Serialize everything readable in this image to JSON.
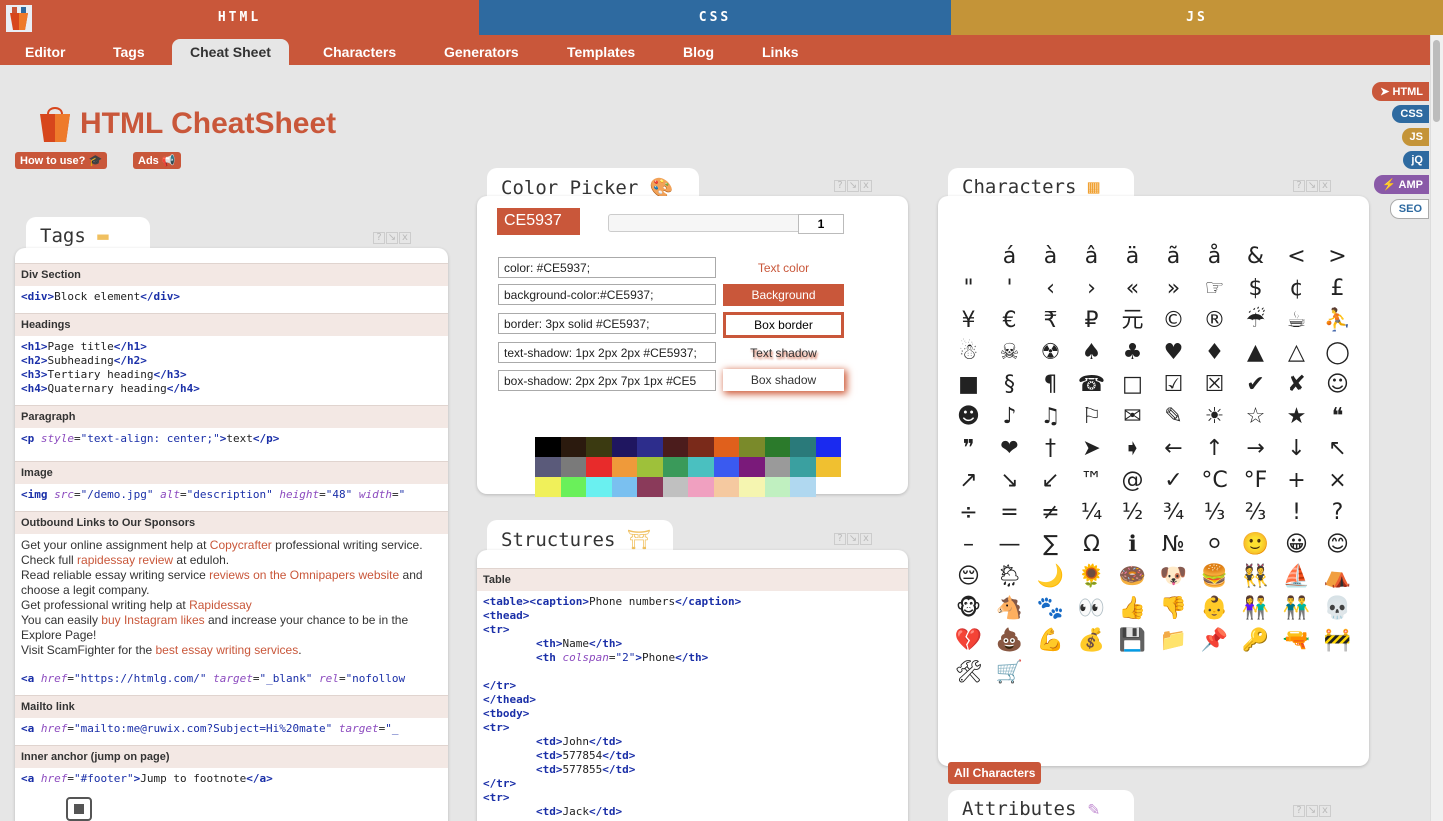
{
  "topbar": {
    "html": "HTML",
    "css": "CSS",
    "js": "JS"
  },
  "nav": [
    "Editor",
    "Tags",
    "Cheat Sheet",
    "Characters",
    "Generators",
    "Templates",
    "Blog",
    "Links"
  ],
  "side_tabs": [
    "HTML",
    "CSS",
    "JS",
    "jQ",
    "AMP",
    "SEO"
  ],
  "page_title": "HTML CheatSheet",
  "how_to_use": "How to use? 🎓",
  "ads": "Ads 📢",
  "tags_panel": {
    "title": "Tags",
    "sections": [
      {
        "header": "Div Section",
        "lines": [
          "<div>Block element</div>"
        ]
      },
      {
        "header": "Headings",
        "lines": [
          "<h1>Page title</h1>",
          "<h2>Subheading</h2>",
          "<h3>Tertiary heading</h3>",
          "<h4>Quaternary heading</h4>"
        ]
      },
      {
        "header": "Paragraph",
        "lines": [
          "<p style=\"text-align: center;\">text</p>"
        ]
      },
      {
        "header": "Image",
        "lines": [
          "<img src=\"/demo.jpg\" alt=\"description\" height=\"48\" width=\""
        ]
      }
    ],
    "sponsors_header": "Outbound Links to Our Sponsors",
    "sponsor_lines": [
      {
        "pre": "Get your online assignment help at ",
        "link": "Copycrafter",
        "post": " professional writing service."
      },
      {
        "pre": "Check full ",
        "link": "rapidessay review",
        "post": " at eduloh."
      },
      {
        "pre": "Read reliable essay writing service ",
        "link": "reviews on the Omnipapers website",
        "post": " and choose a legit company."
      },
      {
        "pre": "Get professional writing help at ",
        "link": "Rapidessay",
        "post": ""
      },
      {
        "pre": "You can easily ",
        "link": "buy Instagram likes",
        "post": " and increase your chance to be in the Explore Page!"
      },
      {
        "pre": "Visit ScamFighter for the ",
        "link": "best essay writing services",
        "post": "."
      }
    ],
    "sponsor_code": "<a href=\"https://htmlg.com/\" target=\"_blank\" rel=\"nofollow",
    "mailto_header": "Mailto link",
    "mailto_code": "<a href=\"mailto:me@ruwix.com?Subject=Hi%20mate\" target=\"_",
    "anchor_header": "Inner anchor (jump on page)",
    "anchor_code": "<a href=\"#footer\">Jump to footnote</a>"
  },
  "color_picker": {
    "title": "Color Picker 🎨",
    "hex": "CE5937",
    "slider_value": "1",
    "rows": [
      {
        "code": "color: #CE5937;",
        "label": "Text color"
      },
      {
        "code": "background-color:#CE5937;",
        "label": "Background"
      },
      {
        "code": "border: 3px solid #CE5937;",
        "label": "Box border"
      },
      {
        "code": "text-shadow: 1px 2px 2px #CE5937;",
        "label": "Text shadow"
      },
      {
        "code": "box-shadow: 2px 2px 7px 1px #CE5",
        "label": "Box shadow"
      }
    ],
    "swatches": [
      "#000000",
      "#2b1a0e",
      "#3b3a11",
      "#1f1660",
      "#2d2d8c",
      "#4b1c1c",
      "#7a2a1a",
      "#e0601c",
      "#7a8a2a",
      "#2b7a2b",
      "#2a7a7a",
      "#1a2af0",
      "#5a5a7a",
      "#7a7a7a",
      "#e82b2b",
      "#ef9a3a",
      "#9ec13a",
      "#3a9a5a",
      "#4ac0c0",
      "#3a5af0",
      "#7a1a7a",
      "#9a9a9a",
      "#3aa0a0",
      "#f0c030",
      "#f0f05a",
      "#6af05a",
      "#6af0f0",
      "#7ac0f0",
      "#8a3a5a",
      "#c0c0c0",
      "#f0a0c0",
      "#f5c9a0",
      "#f5f5b0",
      "#c0f0c0",
      "#b0d8f0"
    ]
  },
  "structures_panel": {
    "title": "Structures",
    "header": "Table",
    "lines": [
      "<table><caption>Phone numbers</caption>",
      "<thead>",
      "<tr>",
      "        <th>Name</th>",
      "        <th colspan=\"2\">Phone</th>",
      "</tr>",
      "</thead>",
      "<tbody>",
      "<tr>",
      "        <td>John</td>",
      "        <td>577854</td>",
      "        <td>577855</td>",
      "</tr>",
      "<tr>",
      "        <td>Jack</td>"
    ]
  },
  "characters_panel": {
    "title": "Characters",
    "chars": [
      "",
      "á",
      "à",
      "â",
      "ä",
      "ã",
      "å",
      "&",
      "<",
      ">",
      "\"",
      "'",
      "‹",
      "›",
      "«",
      "»",
      "☞",
      "$",
      "¢",
      "£",
      "¥",
      "€",
      "₹",
      "₽",
      "元",
      "©",
      "®",
      "☔",
      "☕",
      "⛹",
      "☃",
      "☠",
      "☢",
      "♠",
      "♣",
      "♥",
      "♦",
      "▲",
      "△",
      "◯",
      "■",
      "§",
      "¶",
      "☎",
      "□",
      "☑",
      "☒",
      "✔",
      "✘",
      "☺",
      "☻",
      "♪",
      "♫",
      "⚐",
      "✉",
      "✎",
      "☀",
      "☆",
      "★",
      "❝",
      "❞",
      "❤",
      "†",
      "➤",
      "➧",
      "←",
      "↑",
      "→",
      "↓",
      "↖",
      "↗",
      "↘",
      "↙",
      "™",
      "@",
      "✓",
      "°C",
      "°F",
      "+",
      "×",
      "÷",
      "=",
      "≠",
      "¼",
      "½",
      "¾",
      "⅓",
      "⅔",
      "!",
      "?",
      "–",
      "—",
      "∑",
      "Ω",
      "ℹ",
      "№",
      "⚪",
      "🙂",
      "😀",
      "😊",
      "😔",
      "🌦",
      "🌙",
      "🌻",
      "🍩",
      "🐶",
      "🍔",
      "👯",
      "⛵",
      "⛺",
      "🐵",
      "🐴",
      "🐾",
      "👀",
      "👍",
      "👎",
      "👶",
      "👫",
      "👬",
      "💀",
      "💔",
      "💩",
      "💪",
      "💰",
      "💾",
      "📁",
      "📌",
      "🔑",
      "🔫",
      "🚧",
      "🛠",
      "🛒"
    ],
    "all_button": "All Characters"
  },
  "attributes_panel": {
    "title": "Attributes"
  }
}
